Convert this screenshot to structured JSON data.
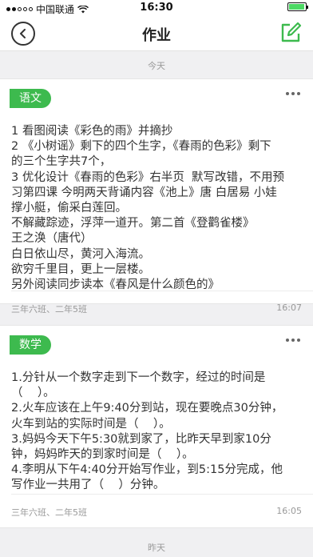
{
  "status_bar": {
    "carrier": "中国联通",
    "time": "16:30",
    "battery_level": 0.95
  },
  "nav": {
    "title": "作业",
    "back_icon": "chevron-left-icon",
    "edit_icon": "edit-square-icon"
  },
  "colors": {
    "accent": "#3dba4e",
    "background": "#f0f0f2"
  },
  "dividers": {
    "today": "今天",
    "yesterday": "昨天"
  },
  "cards": [
    {
      "subject": "语文",
      "lines": [
        "1 看图阅读《彩色的雨》并摘抄",
        "2 《小树谣》剩下的四个生字，《春雨的色彩》剩下",
        "的三个生字共7个，",
        "3 优化设计《春雨的色彩》右半页  默写改错，不用预",
        "习第四课 今明两天背诵内容《池上》唐 白居易 小娃",
        "撑小艇，偷采白莲回。",
        "不解藏踪迹，浮萍一道开。第二首《登鹳雀楼》",
        "王之涣（唐代）",
        "白日依山尽，黄河入海流。",
        "欲穷千里目，更上一层楼。",
        "另外阅读同步读本《春风是什么颜色的》"
      ],
      "classes": "三年六班、二年5班",
      "time": "16:07"
    },
    {
      "subject": "数学",
      "lines": [
        "1.分针从一个数字走到下一个数字，经过的时间是",
        "（    ）。",
        "2.火车应该在上午9:40分到站，现在要晚点30分钟，",
        "火车到站的实际时间是（    ）。",
        "3.妈妈今天下午5:30就到家了，比昨天早到家10分",
        "钟，妈妈昨天的到家时间是（    ）。",
        "4.李明从下午4:40分开始写作业，到5:15分完成，他",
        "写作业一共用了（    ）分钟。"
      ],
      "classes": "三年六班、二年5班",
      "time": "16:05"
    }
  ]
}
